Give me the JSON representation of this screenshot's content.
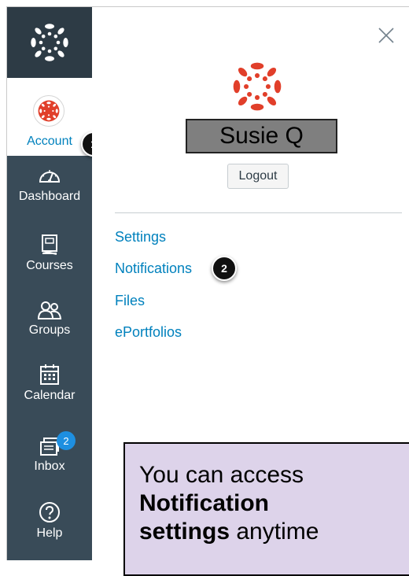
{
  "sidebar": {
    "account_label": "Account",
    "items": [
      {
        "label": "Dashboard",
        "icon": "dashboard-icon"
      },
      {
        "label": "Courses",
        "icon": "courses-icon"
      },
      {
        "label": "Groups",
        "icon": "groups-icon"
      },
      {
        "label": "Calendar",
        "icon": "calendar-icon"
      },
      {
        "label": "Inbox",
        "icon": "inbox-icon",
        "badge": "2"
      },
      {
        "label": "Help",
        "icon": "help-icon"
      }
    ]
  },
  "steps": {
    "one": "1",
    "two": "2"
  },
  "tray": {
    "user_name": "Susie Q",
    "logout_label": "Logout",
    "links": [
      {
        "label": "Settings"
      },
      {
        "label": "Notifications"
      },
      {
        "label": "Files"
      },
      {
        "label": "ePortfolios"
      }
    ]
  },
  "callout": {
    "line1": "You can access",
    "bold1": "Notification",
    "bold2": "settings",
    "rest": " anytime"
  },
  "colors": {
    "sidebar_bg": "#394b58",
    "logo_bg": "#2d3b45",
    "link": "#0081bd",
    "brand_red": "#e13f2a",
    "callout_bg": "#ddd3ea"
  }
}
